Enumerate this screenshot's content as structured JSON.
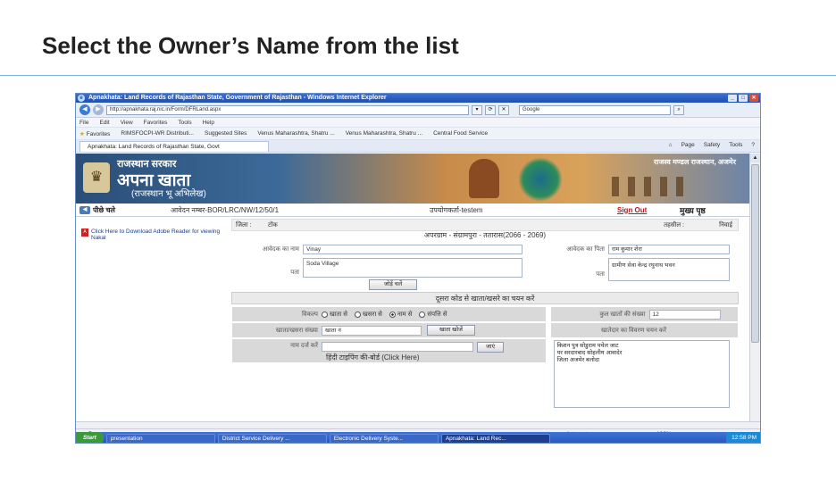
{
  "slide": {
    "title": "Select the Owner’s Name from the list"
  },
  "browser": {
    "window_title": "Apnakhata: Land Records of Rajasthan State, Government of Rajasthan - Windows Internet Explorer",
    "address": "http://apnakhata.raj.nic.in/Form/DFRLand.aspx",
    "search_placeholder": "Google",
    "menu": [
      "File",
      "Edit",
      "View",
      "Favorites",
      "Tools",
      "Help"
    ],
    "favorites_label": "Favorites",
    "favorites": [
      "RIMSFOCPI-WR Distributi...",
      "Suggested Sites",
      "Venus Maharashtra, Shatru ...",
      "Venus Maharashtra, Shatru ...",
      "Central Food  Service"
    ],
    "tab_title": "Apnakhata: Land Records of Rajasthan State, Govt",
    "toolbar_tools": [
      "Page",
      "Safety",
      "Tools"
    ],
    "status": "Done",
    "zone": "Internet",
    "zoom": "100%"
  },
  "banner": {
    "line1": "राजस्थान सरकार",
    "line2": "अपना खाता",
    "line3": "(राजस्थान भू अभिलेख)",
    "right_text": "राजस्व मण्डल राजस्थान, अजमेर"
  },
  "nav": {
    "back": "पीछे चले",
    "application_no": "आवेदन नम्बर-BOR/LRC/NW/12/50/1",
    "user": "उपयोगकर्ता-testem",
    "signout": "Sign Out",
    "home": "मुख्य पृष्ठ"
  },
  "left_panel": {
    "pdf_text": "Click Here to Download Adobe Reader for viewing Nakal"
  },
  "form": {
    "district_label": "जिला :",
    "district_value": "टोंक",
    "tehsil_label": "तहसील :",
    "tehsil_value": "निवाई",
    "circle": "अपरग्राम - संग्रामपुरा - ततारास(2066 - 2069)",
    "applicant_label": "आवेदक का नाम",
    "applicant_value": "Vinay",
    "applicant_father_label": "आवेदक का पिता",
    "applicant_father_value": "राम कुमार शेरा",
    "address_label": "पता",
    "address_value": "Soda Village",
    "address_right_value": "ग्रामीण सेवा केन्द्र रघुनाथ भवन",
    "add_button": "जोड़ें चलें",
    "section_heading": "दूसरा कोड से खाता/खसरे का चयन करें",
    "search_label": "विकल्प",
    "radio_options": [
      "खाता से",
      "खसरा से",
      "नाम से",
      "संपत्ति से"
    ],
    "selected_radio": 2,
    "khata_label": "खाता/खसरा संख्या",
    "khata_value": "खाता नं",
    "search_button": "खाता खोजें",
    "name_label": "नाम दर्ज करें",
    "go_button": "जाएं",
    "hindi_link": "हिंदी टाइपिंग की-बोर्ड (Click Here)",
    "khata_count_label": "कुल खातों की संख्या",
    "khata_count_value": "12",
    "owner_select_label": "खातेदार का विवरण चयन करें",
    "owners": [
      "किशन पुत्र सोडुराम पचेल जाट",
      "पर सरदारबाद सोहलीय आवादेर",
      "जिला अजमेर बलोदा"
    ]
  },
  "taskbar": {
    "start": "Start",
    "tasks": [
      "presentation",
      "District Service Delivery ...",
      "Electronic Delivery Syste...",
      "Apnakhata: Land Rec..."
    ],
    "time": "12:58 PM"
  }
}
